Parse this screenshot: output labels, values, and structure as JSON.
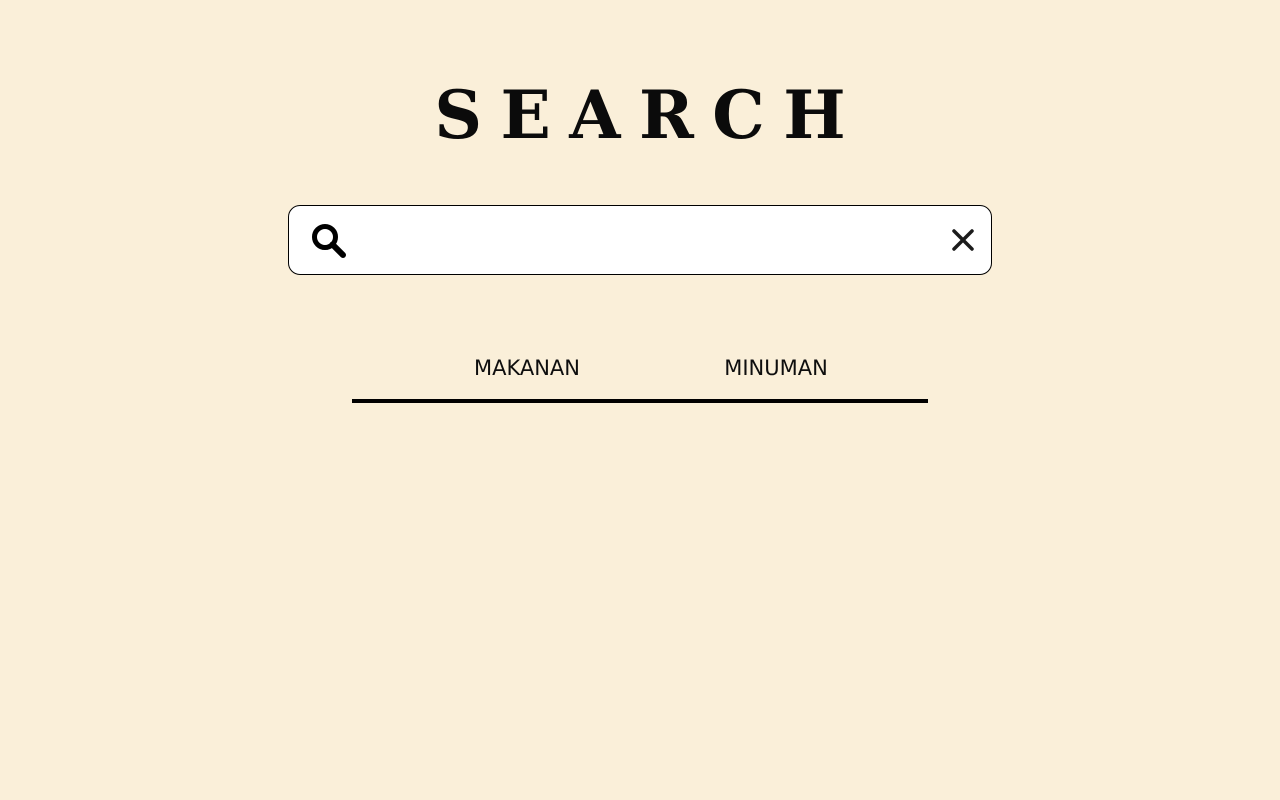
{
  "page": {
    "title": "SEARCH",
    "background_color": "#faefd9"
  },
  "search": {
    "value": "",
    "placeholder": "",
    "search_icon": "search-icon",
    "clear_icon": "close-icon"
  },
  "tabs": [
    {
      "label": "MAKANAN"
    },
    {
      "label": "MINUMAN"
    }
  ]
}
